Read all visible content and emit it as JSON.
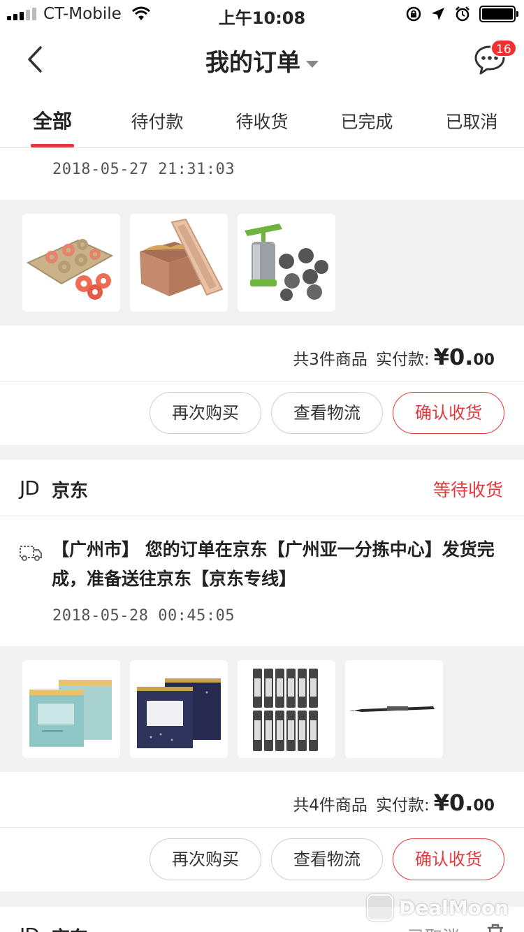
{
  "status_bar": {
    "carrier": "CT-Mobile",
    "time": "上午10:08",
    "icons": [
      "signal-icon",
      "wifi-icon",
      "orientation-lock-icon",
      "location-icon",
      "alarm-icon",
      "battery-icon"
    ]
  },
  "nav": {
    "title": "我的订单",
    "message_badge": "16",
    "icons": [
      "back-arrow-icon",
      "dropdown-caret-icon",
      "message-bubble-icon"
    ]
  },
  "tabs": [
    {
      "label": "全部",
      "active": true
    },
    {
      "label": "待付款",
      "active": false
    },
    {
      "label": "待收货",
      "active": false
    },
    {
      "label": "已完成",
      "active": false
    },
    {
      "label": "已取消",
      "active": false
    }
  ],
  "orders": [
    {
      "timestamp": "2018-05-27 21:31:03",
      "products": [
        "donut-pan",
        "loaf-pan",
        "cookie-press"
      ],
      "count_label": "共3件商品",
      "paid_label": "实付款:",
      "paid_int": "¥0.",
      "paid_dec": "00",
      "buttons": {
        "rebuy": "再次购买",
        "logistics": "查看物流",
        "confirm": "确认收货"
      }
    },
    {
      "shop_logo": "JD",
      "shop": "京东",
      "status": "等待收货",
      "tracking": "【广州市】 您的订单在京东【广州亚一分拣中心】发货完成，准备送往京东【京东专线】",
      "timestamp": "2018-05-28 00:45:05",
      "products": [
        "face-mask-teal",
        "face-mask-navy",
        "pencil-leads",
        "mechanical-pencil"
      ],
      "count_label": "共4件商品",
      "paid_label": "实付款:",
      "paid_int": "¥0.",
      "paid_dec": "00",
      "buttons": {
        "rebuy": "再次购买",
        "logistics": "查看物流",
        "confirm": "确认收货"
      }
    },
    {
      "shop_logo": "JD",
      "shop": "京东",
      "status": "已取消"
    }
  ],
  "watermark": "DealMoon",
  "colors": {
    "accent": "#e4393c",
    "badge": "#f23030",
    "background": "#f2f2f2"
  }
}
